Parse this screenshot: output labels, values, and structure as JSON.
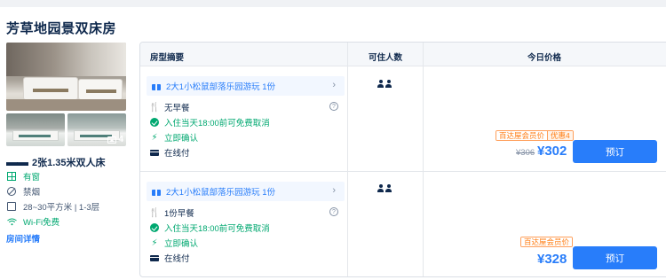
{
  "room": {
    "title": "芳草地园景双床房",
    "photo_count": "4",
    "bed": "2张1.35米双人床",
    "attributes": [
      {
        "icon": "window-icon",
        "text": "有窗",
        "highlight": true
      },
      {
        "icon": "no-smoking-icon",
        "text": "禁烟",
        "highlight": false
      },
      {
        "icon": "area-icon",
        "text": "28~30平方米 | 1-3层",
        "highlight": false
      },
      {
        "icon": "wifi-icon",
        "text": "Wi-Fi免费",
        "highlight": true
      }
    ],
    "detail_link": "房间详情"
  },
  "table": {
    "headers": {
      "plan": "房型摘要",
      "occupancy": "可住人数",
      "price": "今日价格"
    },
    "rows": [
      {
        "package": "2大1小松鼠部落乐园游玩 1份",
        "breakfast": "无早餐",
        "cancel": "入住当天18:00前可免费取消",
        "confirm": "立即确认",
        "payment": "在线付",
        "occupancy_icon": "two-adults-icon",
        "member_label": "百达屋会员价",
        "discount_label": "优惠4",
        "original_price": "¥306",
        "price": "¥302",
        "book_label": "预订"
      },
      {
        "package": "2大1小松鼠部落乐园游玩 1份",
        "breakfast": "1份早餐",
        "cancel": "入住当天18:00前可免费取消",
        "confirm": "立即确认",
        "payment": "在线付",
        "occupancy_icon": "two-adults-icon",
        "member_label": "百达屋会员价",
        "price": "¥328",
        "book_label": "预订"
      }
    ]
  },
  "colors": {
    "primary": "#287dfa",
    "green": "#00a870",
    "orange": "#ff7d13",
    "text": "#0f294d"
  }
}
